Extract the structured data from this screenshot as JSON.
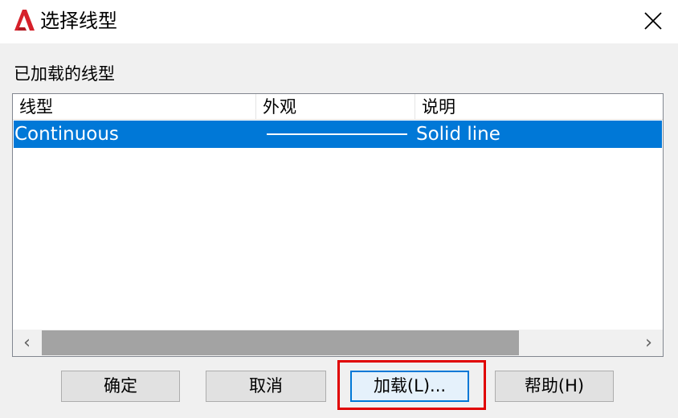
{
  "window": {
    "title": "选择线型",
    "app_icon": "autocad-logo-icon",
    "close_icon": "close-icon"
  },
  "section": {
    "label": "已加载的线型"
  },
  "listview": {
    "columns": [
      "线型",
      "外观",
      "说明"
    ],
    "rows": [
      {
        "linetype": "Continuous",
        "appearance": "solid-line-sample",
        "description": "Solid line",
        "selected": true
      }
    ],
    "scroll_left_icon": "‹",
    "scroll_right_icon": "›"
  },
  "buttons": {
    "ok": "确定",
    "cancel": "取消",
    "load": "加载(L)...",
    "help": "帮助(H)"
  },
  "colors": {
    "accent": "#0078d7",
    "highlight": "#e00000",
    "brand": "#d6202a"
  }
}
